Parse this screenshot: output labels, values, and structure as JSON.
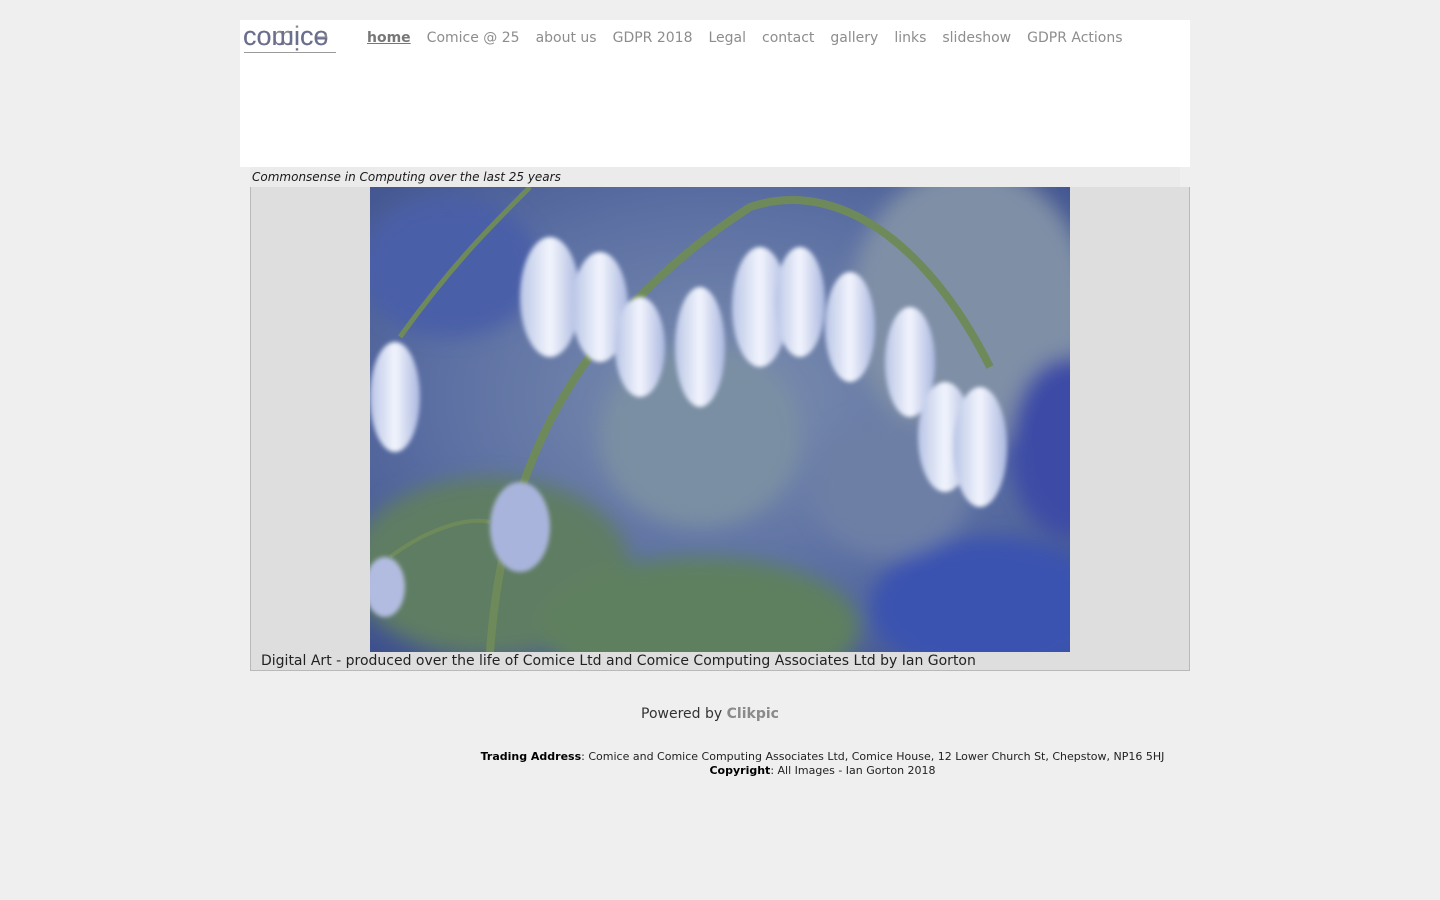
{
  "logo": {
    "text": "comice",
    "mirrored_text": "comice"
  },
  "nav": {
    "items": [
      {
        "label": "home",
        "active": true
      },
      {
        "label": "Comice @ 25"
      },
      {
        "label": "about us"
      },
      {
        "label": "GDPR 2018"
      },
      {
        "label": "Legal"
      },
      {
        "label": "contact"
      },
      {
        "label": "gallery"
      },
      {
        "label": "links"
      },
      {
        "label": "slideshow"
      },
      {
        "label": "GDPR Actions"
      }
    ]
  },
  "tagline": "Commonsense in Computing over the last 25 years",
  "gallery": {
    "caption": "Digital Art - produced over the life of Comice Ltd and Comice Computing Associates Ltd by Ian Gorton"
  },
  "powered": {
    "prefix": "Powered by",
    "link": "Clikpic"
  },
  "footer": {
    "trading_label": "Trading Address",
    "trading_value": ": Comice and Comice Computing Associates Ltd, Comice House, 12 Lower Church St, Chepstow, NP16 5HJ",
    "copyright_label": "Copyright",
    "copyright_value": ": All Images - Ian Gorton 2018"
  },
  "colors": {
    "page_bg": "#efefef",
    "nav_text": "#8d8d8d",
    "panel_bg": "#dedede",
    "link_accent": "#8a8a8a"
  }
}
